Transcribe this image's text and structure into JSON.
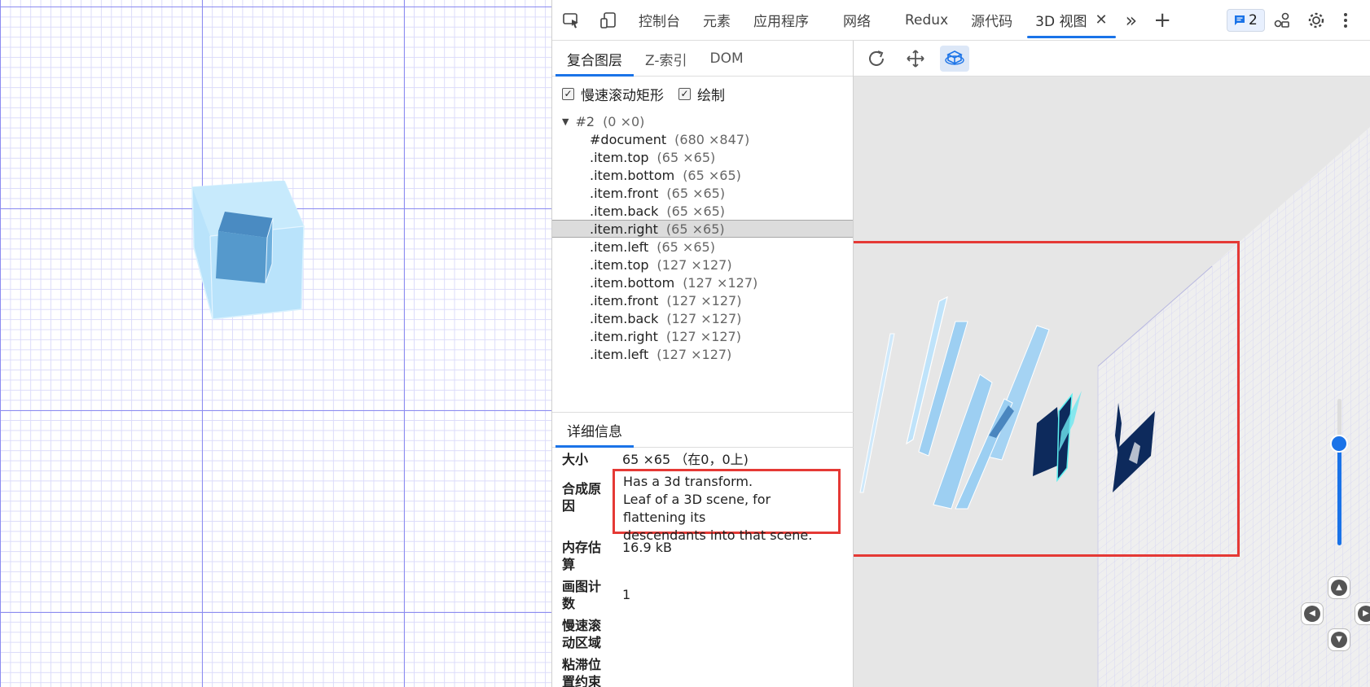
{
  "devtools": {
    "tabs": [
      "控制台",
      "元素",
      "应用程序",
      "网络",
      "Redux",
      "源代码",
      "3D 视图"
    ],
    "active_tab": "3D 视图",
    "close_glyph": "✕",
    "more_glyph": "»",
    "add_glyph": "+",
    "issues_count": "2"
  },
  "layers": {
    "subtabs": [
      "复合图层",
      "Z-索引",
      "DOM"
    ],
    "checkboxes": [
      {
        "label": "慢速滚动矩形",
        "checked": true
      },
      {
        "label": "绘制",
        "checked": true
      }
    ],
    "root": {
      "name": "#2",
      "dims": "(0 ×0)"
    },
    "items": [
      {
        "name": "#document",
        "dims": "(680 ×847)"
      },
      {
        "name": ".item.top",
        "dims": "(65 ×65)"
      },
      {
        "name": ".item.bottom",
        "dims": "(65 ×65)"
      },
      {
        "name": ".item.front",
        "dims": "(65 ×65)"
      },
      {
        "name": ".item.back",
        "dims": "(65 ×65)"
      },
      {
        "name": ".item.right",
        "dims": "(65 ×65)",
        "selected": true
      },
      {
        "name": ".item.left",
        "dims": "(65 ×65)"
      },
      {
        "name": ".item.top",
        "dims": "(127 ×127)"
      },
      {
        "name": ".item.bottom",
        "dims": "(127 ×127)"
      },
      {
        "name": ".item.front",
        "dims": "(127 ×127)"
      },
      {
        "name": ".item.back",
        "dims": "(127 ×127)"
      },
      {
        "name": ".item.right",
        "dims": "(127 ×127)"
      },
      {
        "name": ".item.left",
        "dims": "(127 ×127)"
      }
    ]
  },
  "details": {
    "tab": "详细信息",
    "size_label": "大小",
    "size_value": "65 ×65 （在0，0上)",
    "reason_label_1": "合成原",
    "reason_label_2": "因",
    "reason_lines": [
      "Has a 3d transform.",
      "Leaf of a 3D scene, for flattening its",
      "descendants into that scene."
    ],
    "memory_label_1": "内存估",
    "memory_label_2": "算",
    "memory_value": "16.9 kB",
    "paint_label_1": "画图计",
    "paint_label_2": "数",
    "paint_value": "1",
    "slow_label_1": "慢速滚",
    "slow_label_2": "动区域",
    "sticky_label_1": "粘滞位",
    "sticky_label_2": "置约束"
  },
  "colors": {
    "accent": "#1a73e8",
    "highlight": "#e53935",
    "cube_outer": "#aee0fb",
    "cube_inner": "#5599cc",
    "layer_dark": "#0d2a5c"
  }
}
